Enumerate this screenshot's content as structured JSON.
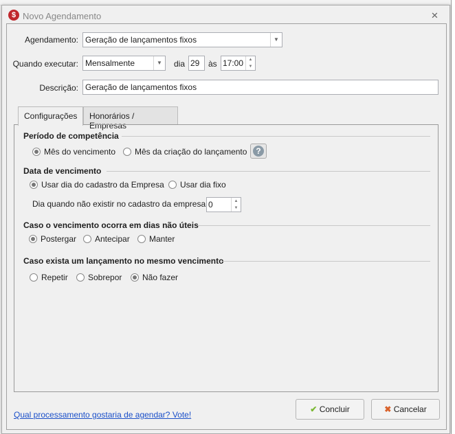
{
  "window": {
    "title": "Novo Agendamento",
    "close": "✕",
    "app_icon": "$"
  },
  "form": {
    "agendamento_label": "Agendamento:",
    "agendamento_value": "Geração de lançamentos fixos",
    "quando_label": "Quando executar:",
    "quando_value": "Mensalmente",
    "dia_label": "dia",
    "dia_value": "29",
    "as_label": "às",
    "hora_value": "17:00",
    "descricao_label": "Descrição:",
    "descricao_value": "Geração de lançamentos fixos"
  },
  "tabs": [
    {
      "label": "Configurações",
      "active": true
    },
    {
      "label": "Honorários / Empresas",
      "active": false
    }
  ],
  "config": {
    "periodo": {
      "title": "Período de competência",
      "options": [
        "Mês do vencimento",
        "Mês da criação do lançamento"
      ],
      "help": "?"
    },
    "data": {
      "title": "Data de vencimento",
      "options": [
        "Usar dia do cadastro da Empresa",
        "Usar dia fixo"
      ],
      "dia_label": "Dia quando não existir no cadastro da empresa",
      "dia_value": "0"
    },
    "uteis": {
      "title": "Caso o vencimento ocorra em dias não úteis",
      "options": [
        "Postergar",
        "Antecipar",
        "Manter"
      ]
    },
    "mesmo": {
      "title": "Caso exista um lançamento no mesmo vencimento",
      "options": [
        "Repetir",
        "Sobrepor",
        "Não fazer"
      ]
    }
  },
  "footer": {
    "link": "Qual processamento gostaria de agendar? Vote!",
    "concluir": "Concluir",
    "cancelar": "Cancelar"
  }
}
